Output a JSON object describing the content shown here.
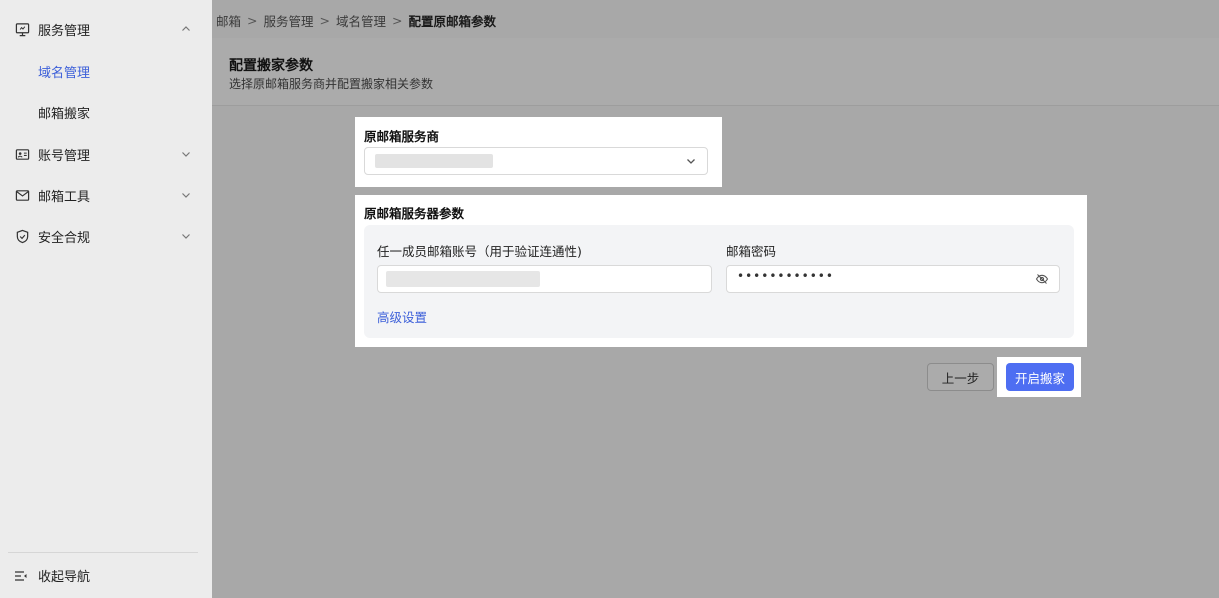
{
  "sidebar": {
    "groups": [
      {
        "label": "服务管理",
        "icon": "monitor-icon",
        "expanded": true,
        "children": [
          {
            "label": "域名管理",
            "active": true
          },
          {
            "label": "邮箱搬家",
            "active": false
          }
        ]
      },
      {
        "label": "账号管理",
        "icon": "id-card-icon",
        "expanded": false
      },
      {
        "label": "邮箱工具",
        "icon": "mail-icon",
        "expanded": false
      },
      {
        "label": "安全合规",
        "icon": "shield-check-icon",
        "expanded": false
      }
    ],
    "collapse_label": "收起导航"
  },
  "breadcrumb": {
    "items": [
      "邮箱",
      "服务管理",
      "域名管理"
    ],
    "current": "配置原邮箱参数",
    "separator": ">"
  },
  "header": {
    "title": "配置搬家参数",
    "subtitle": "选择原邮箱服务商并配置搬家相关参数"
  },
  "provider_section": {
    "label": "原邮箱服务商",
    "selected_value": ""
  },
  "server_section": {
    "label": "原邮箱服务器参数",
    "account_label": "任一成员邮箱账号（用于验证连通性)",
    "account_value": "",
    "password_label": "邮箱密码",
    "password_value": "••••••••••••",
    "advanced_link": "高级设置"
  },
  "actions": {
    "prev_label": "上一步",
    "start_label": "开启搬家"
  },
  "colors": {
    "accent": "#4e6ef2",
    "link": "#3c5fd9",
    "sidebar_bg": "#ececec",
    "overlay": "#a8a8a8"
  }
}
